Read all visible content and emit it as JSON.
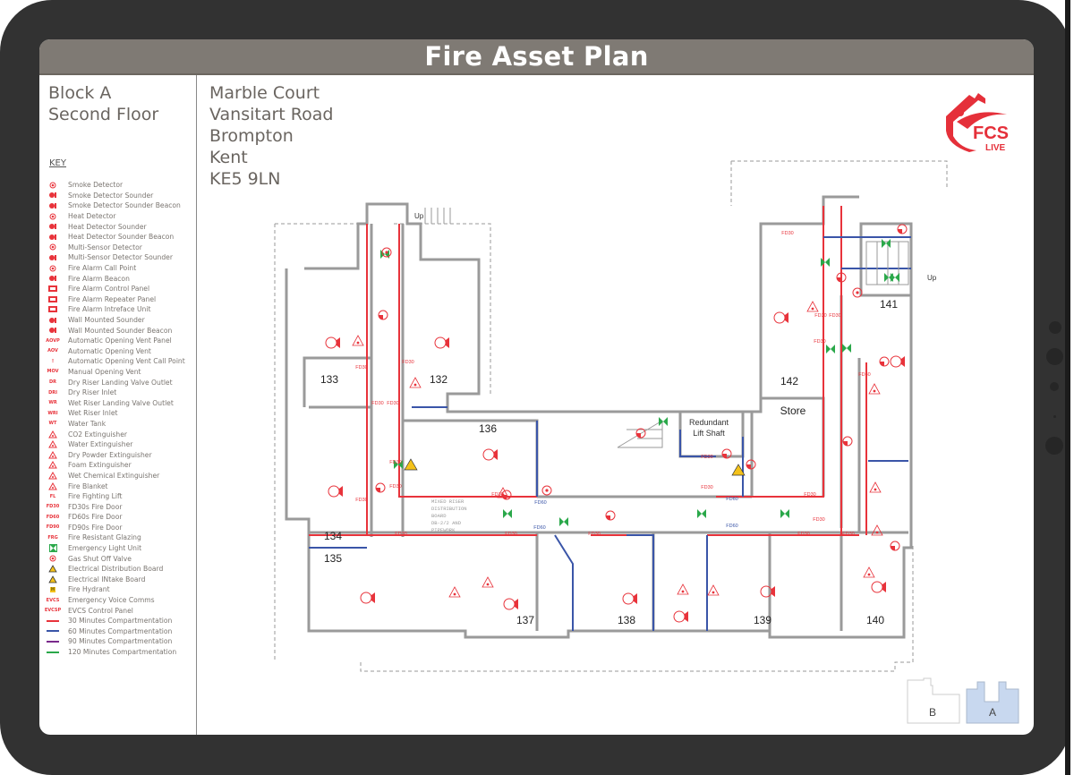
{
  "header": {
    "title": "Fire Asset Plan"
  },
  "location": {
    "block": "Block A",
    "floor": "Second Floor",
    "address_lines": [
      "Marble Court",
      "Vansitart Road",
      "Brompton",
      "Kent",
      "KE5 9LN"
    ]
  },
  "brand": {
    "name": "FCS",
    "subtitle": "LIVE",
    "color": "#e5303a"
  },
  "key": {
    "heading": "KEY",
    "items": [
      {
        "label": "Smoke Detector",
        "icon": "smoke-detector-icon"
      },
      {
        "label": "Smoke Detector Sounder",
        "icon": "smoke-detector-sounder-icon"
      },
      {
        "label": "Smoke Detector Sounder Beacon",
        "icon": "smoke-detector-sounder-beacon-icon"
      },
      {
        "label": "Heat Detector",
        "icon": "heat-detector-icon"
      },
      {
        "label": "Heat Detector Sounder",
        "icon": "heat-detector-sounder-icon"
      },
      {
        "label": "Heat Detector Sounder Beacon",
        "icon": "heat-detector-sounder-beacon-icon"
      },
      {
        "label": "Multi-Sensor Detector",
        "icon": "multi-sensor-detector-icon"
      },
      {
        "label": "Multi-Sensor Detector Sounder",
        "icon": "multi-sensor-detector-sounder-icon"
      },
      {
        "label": "Fire Alarm Call Point",
        "icon": "call-point-icon"
      },
      {
        "label": "Fire Alarm Beacon",
        "icon": "beacon-icon"
      },
      {
        "label": "Fire Alarm Control Panel",
        "icon": "control-panel-icon"
      },
      {
        "label": "Fire Alarm Repeater Panel",
        "icon": "repeater-panel-icon"
      },
      {
        "label": "Fire Alarm Intreface Unit",
        "icon": "interface-unit-icon"
      },
      {
        "label": "Wall Mounted Sounder",
        "icon": "wall-sounder-icon"
      },
      {
        "label": "Wall Mounted Sounder Beacon",
        "icon": "wall-sounder-beacon-icon"
      },
      {
        "label": "Automatic Opening Vent Panel",
        "icon": "aov-panel-icon",
        "code": "AOVP"
      },
      {
        "label": "Automatic Opening Vent",
        "icon": "aov-icon",
        "code": "AOV"
      },
      {
        "label": "Automatic Opening Vent Call Point",
        "icon": "aov-call-point-icon",
        "code": "!"
      },
      {
        "label": "Manual Opening Vent",
        "icon": "mov-icon",
        "code": "MOV"
      },
      {
        "label": "Dry Riser Landing Valve Outlet",
        "icon": "dry-riser-outlet-icon",
        "code": "DR"
      },
      {
        "label": "Dry Riser Inlet",
        "icon": "dry-riser-inlet-icon",
        "code": "DRI"
      },
      {
        "label": "Wet Riser Landing Valve Outlet",
        "icon": "wet-riser-outlet-icon",
        "code": "WR"
      },
      {
        "label": "Wet Riser Inlet",
        "icon": "wet-riser-inlet-icon",
        "code": "WRI"
      },
      {
        "label": "Water Tank",
        "icon": "water-tank-icon",
        "code": "WT"
      },
      {
        "label": "CO2 Extinguisher",
        "icon": "co2-extinguisher-icon"
      },
      {
        "label": "Water Extinguisher",
        "icon": "water-extinguisher-icon"
      },
      {
        "label": "Dry Powder Extinguisher",
        "icon": "dry-powder-extinguisher-icon"
      },
      {
        "label": "Foam Extinguisher",
        "icon": "foam-extinguisher-icon"
      },
      {
        "label": "Wet Chemical Extinguisher",
        "icon": "wet-chemical-extinguisher-icon"
      },
      {
        "label": "Fire Blanket",
        "icon": "fire-blanket-icon"
      },
      {
        "label": "Fire Fighting Lift",
        "icon": "fire-fighting-lift-icon",
        "code": "FL"
      },
      {
        "label": "FD30s Fire Door",
        "icon": "fd30-door-icon",
        "code": "fd30"
      },
      {
        "label": "FD60s Fire Door",
        "icon": "fd60-door-icon",
        "code": "fd60"
      },
      {
        "label": "FD90s Fire Door",
        "icon": "fd90-door-icon",
        "code": "fd90"
      },
      {
        "label": "Fire Resistant Glazing",
        "icon": "fire-glazing-icon",
        "code": "FRG"
      },
      {
        "label": "Emergency Light Unit",
        "icon": "emergency-light-icon"
      },
      {
        "label": "Gas Shut Off Valve",
        "icon": "gas-valve-icon"
      },
      {
        "label": "Electrical Distribution Board",
        "icon": "electrical-distribution-icon"
      },
      {
        "label": "Electrical INtake Board",
        "icon": "electrical-intake-icon"
      },
      {
        "label": "Fire Hydrant",
        "icon": "fire-hydrant-icon",
        "code": "H"
      },
      {
        "label": "Emergency Voice Comms",
        "icon": "evc-icon",
        "code": "EVCS"
      },
      {
        "label": "EVCS Control Panel",
        "icon": "evcs-panel-icon",
        "code": "EVCSP"
      },
      {
        "label": "30 Minutes Compartmentation",
        "icon": "line-30-icon",
        "color": "#e8333b"
      },
      {
        "label": "60 Minutes Compartmentation",
        "icon": "line-60-icon",
        "color": "#3a55a8"
      },
      {
        "label": "90 Minutes Compartmentation",
        "icon": "line-90-icon",
        "color": "#7a2a8c"
      },
      {
        "label": "120 Minutes Compartmentation",
        "icon": "line-120-icon",
        "color": "#2aa84a"
      }
    ]
  },
  "plan": {
    "rooms": [
      {
        "id": "133",
        "label": "133"
      },
      {
        "id": "132",
        "label": "132"
      },
      {
        "id": "134",
        "label": "134"
      },
      {
        "id": "135",
        "label": "135"
      },
      {
        "id": "136",
        "label": "136"
      },
      {
        "id": "137",
        "label": "137"
      },
      {
        "id": "138",
        "label": "138"
      },
      {
        "id": "139",
        "label": "139"
      },
      {
        "id": "140",
        "label": "140"
      },
      {
        "id": "141",
        "label": "141"
      },
      {
        "id": "142",
        "label": "142"
      },
      {
        "id": "store",
        "label": "Store"
      },
      {
        "id": "lift",
        "label": "Redundant Lift Shaft"
      }
    ],
    "stair_labels": [
      "Up",
      "Up"
    ],
    "riser_note": [
      "MIXED RISER",
      "DISTRIBUTION",
      "BOARD",
      "DB-2/2 AND",
      "PIPEWORK"
    ],
    "door_labels": {
      "fd30": "FD30",
      "fd60": "FD60"
    },
    "colors": {
      "fd30": "#e8333b",
      "fd60": "#3a55a8",
      "emergency": "#2aa84a",
      "warning": "#f4c21a",
      "wall": "#9a9a9a"
    }
  },
  "minimap": {
    "blocks": [
      {
        "label": "B",
        "active": false
      },
      {
        "label": "A",
        "active": true
      }
    ],
    "active_color": "#c8d8ef"
  }
}
